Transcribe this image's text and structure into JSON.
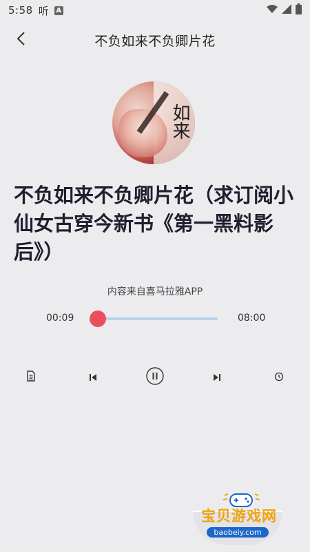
{
  "status_bar": {
    "time": "5:58",
    "app_glyph": "听",
    "a_badge": "A",
    "icons": [
      "wifi-icon",
      "signal-icon",
      "battery-icon"
    ]
  },
  "header": {
    "title": "不负如来不负卿片花",
    "back_icon": "chevron-left-icon"
  },
  "cover": {
    "calligraphy": "如来"
  },
  "book": {
    "title": "不负如来不负卿片花（求订阅小仙女古穿今新书《第一黑料影后》）"
  },
  "source_note": "内容来自喜马拉雅APP",
  "player": {
    "current_time": "00:09",
    "total_time": "08:00",
    "progress": 0.02,
    "accent_color": "#ec4f5c",
    "track_color": "#bcd2ea"
  },
  "controls": [
    {
      "name": "document-icon"
    },
    {
      "name": "previous-icon"
    },
    {
      "name": "pause-icon"
    },
    {
      "name": "next-icon"
    },
    {
      "name": "timer-icon"
    }
  ],
  "watermark": {
    "text": "宝贝游戏网",
    "url": "baobeiy.com"
  }
}
